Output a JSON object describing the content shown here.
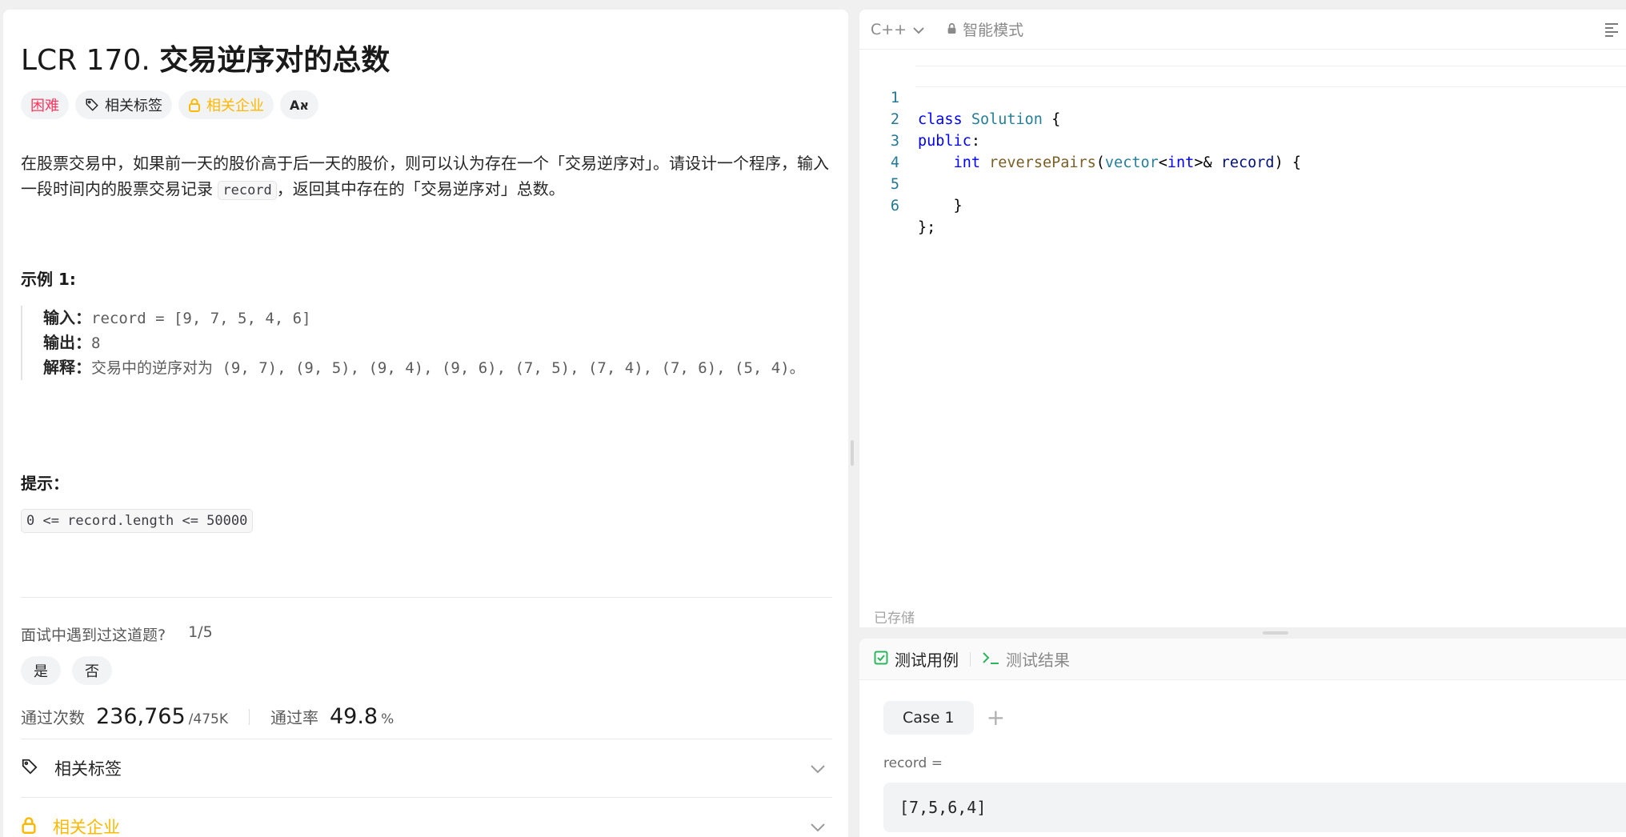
{
  "problem": {
    "number_prefix": "LCR 170.",
    "title": "交易逆序对的总数",
    "tags": {
      "difficulty": "困难",
      "related_tags": "相关标签",
      "related_companies": "相关企业",
      "translate_glyph": "Aא"
    },
    "description_part1": "在股票交易中，如果前一天的股价高于后一天的股价，则可以认为存在一个「交易逆序对」。请设计一个程序，输入一段时间内的股票交易记录 ",
    "description_code": "record",
    "description_part2": "，返回其中存在的「交易逆序对」总数。",
    "example_title": "示例 1:",
    "example": {
      "input_label": "输入：",
      "input_value": "record = [9, 7, 5, 4, 6]",
      "output_label": "输出：",
      "output_value": "8",
      "explain_label": "解释：",
      "explain_value": "交易中的逆序对为 (9, 7), (9, 5), (9, 4), (9, 6), (7, 5), (7, 4), (7, 6), (5, 4)。"
    },
    "hint_title": "提示：",
    "constraint": "0 <= record.length <= 50000",
    "interview": {
      "question": "面试中遇到过这道题?",
      "count": "1/5",
      "yes": "是",
      "no": "否"
    },
    "stats": {
      "accepted_label": "通过次数",
      "accepted_value": "236,765",
      "submissions": "/475K",
      "rate_label": "通过率",
      "rate_value": "49.8",
      "rate_unit": "%"
    },
    "accordion": {
      "tags_label": "相关标签",
      "companies_label": "相关企业"
    }
  },
  "editor": {
    "language": "C++",
    "mode": "智能模式",
    "lines": [
      {
        "num": "1"
      },
      {
        "num": "2"
      },
      {
        "num": "3"
      },
      {
        "num": "4"
      },
      {
        "num": "5"
      },
      {
        "num": "6"
      }
    ],
    "saved_status": "已存储"
  },
  "testpanel": {
    "tab_cases": "测试用例",
    "tab_results": "测试结果",
    "case_label": "Case 1",
    "add_label": "+",
    "param_name": "record =",
    "param_value": "[7,5,6,4]"
  },
  "colors": {
    "difficulty_hard": "#ff375f",
    "locked_amber": "#ffb800",
    "testcase_green": "#2db55d"
  }
}
